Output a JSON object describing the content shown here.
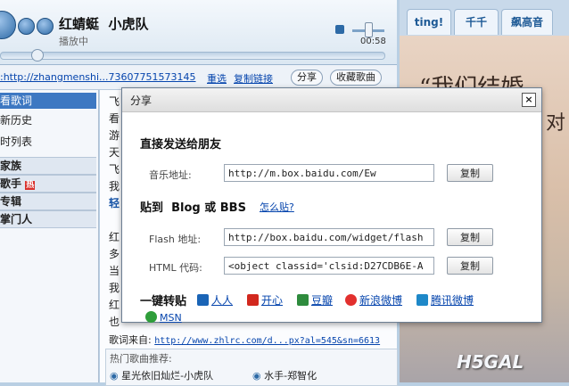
{
  "player": {
    "song": "红蜻蜓",
    "artist": "小虎队",
    "status": "播放中",
    "time": "00:58",
    "progress": 0.07
  },
  "url_bar": {
    "url": ":http://zhangmenshi...73607751573145",
    "reselect": "重选",
    "copy_link": "复制链接",
    "share": "分享",
    "favorite": "收藏歌曲"
  },
  "sidebar": {
    "items": [
      "看歌词",
      "新历史",
      "时列表"
    ],
    "groups": [
      "家族",
      "歌手",
      "专辑",
      "掌门人"
    ],
    "hot_badge": "热"
  },
  "lyrics": {
    "lines": [
      "飞",
      "看",
      "游",
      "天",
      "飞",
      "我",
      "轻",
      "",
      "红",
      "多",
      "当",
      "我",
      "红",
      "也"
    ],
    "source_label": "歌词来自:",
    "source_url": "http://www.zhlrc.com/d...px?al=545&sn=6613",
    "hot_label": "热门歌曲推荐:",
    "hot_songs": [
      "星光依旧灿烂-小虎队",
      "水手-郑智化"
    ]
  },
  "right_tabs": [
    "ting!",
    "千千",
    "飙高音"
  ],
  "banner": {
    "text": "“我们结婚",
    "text2": "对",
    "watermark": "H5GAL"
  },
  "dialog": {
    "title": "分享",
    "close": "×",
    "send_heading": "直接发送给朋友",
    "music_label": "音乐地址:",
    "music_url": "http://m.box.baidu.com/Ew",
    "copy_label": "复制",
    "paste_heading_prefix": "贴到",
    "paste_heading_blog": "Blog",
    "paste_heading_or": "或",
    "paste_heading_bbs": "BBS",
    "how_to": "怎么贴?",
    "flash_label": "Flash 地址:",
    "flash_url": "http://box.baidu.com/widget/flash",
    "html_label": "HTML 代码:",
    "html_code": "<object classid='clsid:D27CDB6E-A",
    "oneclick_heading": "一键转贴",
    "share_sites": [
      "人人",
      "开心",
      "豆瓣",
      "新浪微博",
      "腾讯微博",
      "MSN"
    ]
  },
  "colors": {
    "accent": "#1e5a96",
    "renren": "#1a64b6",
    "kaixin": "#d2281e",
    "douban": "#2e8b3d",
    "sina": "#e2302e",
    "tencent": "#1e88c8",
    "msn": "#2f9e3a"
  }
}
